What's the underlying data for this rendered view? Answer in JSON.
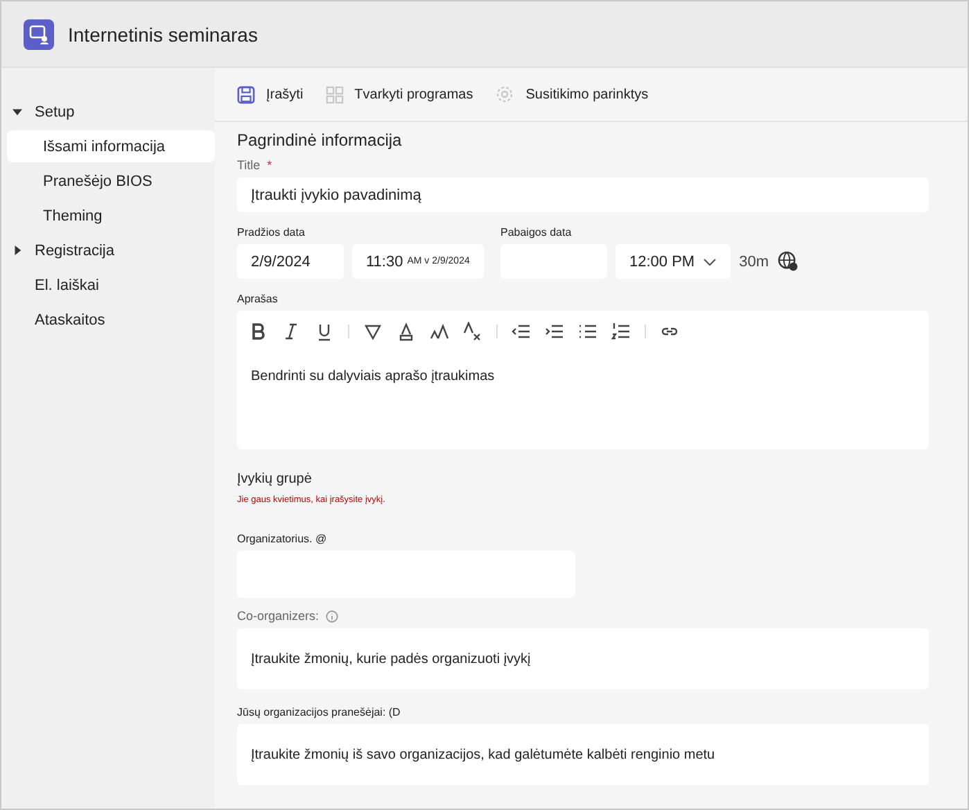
{
  "app": {
    "title": "Internetinis seminaras"
  },
  "sidebar": {
    "items": [
      {
        "label": "Setup",
        "expanded": true,
        "selected": false,
        "children": [
          {
            "label": "Išsami informacija",
            "selected": true
          },
          {
            "label": "Pranešėjo BIOS",
            "selected": false
          },
          {
            "label": "Theming",
            "selected": false
          }
        ]
      },
      {
        "label": "Registracija",
        "expanded": false,
        "selected": false
      },
      {
        "label": "El. laiškai",
        "selected": false
      },
      {
        "label": "Ataskaitos",
        "selected": false
      }
    ]
  },
  "toolbar": [
    {
      "kind": "save",
      "label": "Įrašyti",
      "disabled": false
    },
    {
      "kind": "apps",
      "label": "Tvarkyti programas",
      "disabled": true
    },
    {
      "kind": "settings",
      "label": "Susitikimo parinktys",
      "disabled": true
    }
  ],
  "section_title": "Pagrindinė informacija",
  "title_field": {
    "label": "Title",
    "required_mark": "*",
    "placeholder": "Įtraukti įvykio pavadinimą"
  },
  "start": {
    "label": "Pradžios data",
    "date": "2/9/2024",
    "time": "11:30",
    "time_note": "AM v 2/9/2024"
  },
  "end": {
    "label": "Pabaigos data",
    "time": "12:00 PM",
    "duration": "30m"
  },
  "description": {
    "label": "Aprašas",
    "text": "Bendrinti su dalyviais aprašo įtraukimas"
  },
  "group": {
    "title": "Įvykių grupė",
    "note": "Jie gaus kvietimus, kai įrašysite įvykį."
  },
  "organizer": {
    "label": "Organizatorius. @"
  },
  "coorganizers": {
    "label": "Co-organizers:",
    "placeholder": "Įtraukite žmonių, kurie padės organizuoti įvykį"
  },
  "presenters": {
    "label": "Jūsų organizacijos pranešėjai: (D",
    "placeholder": "Įtraukite žmonių iš savo organizacijos, kad galėtumėte kalbėti renginio metu"
  }
}
